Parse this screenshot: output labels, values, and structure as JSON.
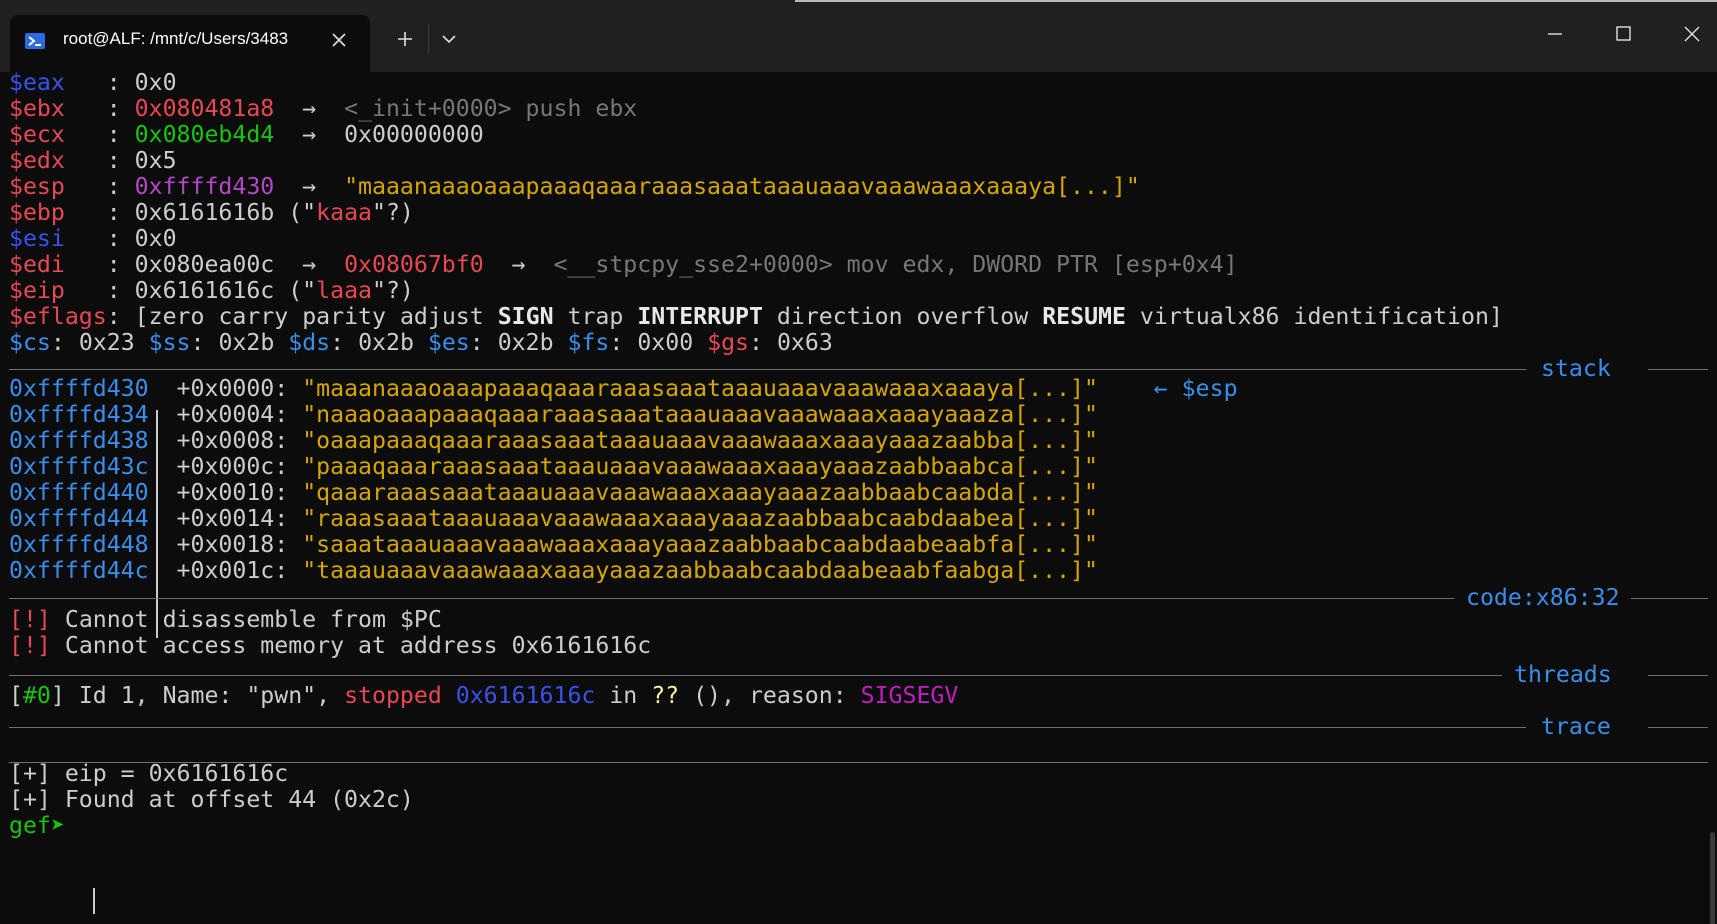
{
  "window": {
    "tab_title": "root@ALF: /mnt/c/Users/3483",
    "icons": {
      "tab": "terminal-icon",
      "close_tab": "close-icon",
      "new_tab": "plus-icon",
      "dropdown": "chevron-down-icon",
      "minimize": "minimize-icon",
      "maximize": "maximize-icon",
      "close_window": "close-icon"
    }
  },
  "colors": {
    "background": "#0c0c0c",
    "titlebar": "#202020",
    "register_blue": "#3b52e8",
    "register_red": "#e74856",
    "address_blue": "#3b8eea",
    "string_yellow": "#d6a600",
    "heap_green": "#16c60c",
    "stack_purple": "#b148c6",
    "signal_magenta": "#c01ec0"
  },
  "registers": {
    "eax": {
      "name": "$eax",
      "pad": "   ",
      "value": "0x0"
    },
    "ebx": {
      "name": "$ebx",
      "pad": "   ",
      "value": "0x080481a8",
      "arrow": "→",
      "deref": "<_init+0000> push ebx"
    },
    "ecx": {
      "name": "$ecx",
      "pad": "   ",
      "value": "0x080eb4d4",
      "arrow": "→",
      "deref": "0x00000000"
    },
    "edx": {
      "name": "$edx",
      "pad": "   ",
      "value": "0x5"
    },
    "esp": {
      "name": "$esp",
      "pad": "   ",
      "value": "0xffffd430",
      "arrow": "→",
      "deref": "\"maaanaaaoaaapaaaqaaaraaasaaataaauaaavaaawaaaxaaaya[...]\""
    },
    "ebp": {
      "name": "$ebp",
      "pad": "   ",
      "value": "0x6161616b",
      "open": " (\"",
      "ascii": "kaaa",
      "close": "\"?)"
    },
    "esi": {
      "name": "$esi",
      "pad": "   ",
      "value": "0x0"
    },
    "edi": {
      "name": "$edi",
      "pad": "   ",
      "value": "0x080ea00c",
      "arrow": "→",
      "deref_ptr": "0x08067bf0",
      "arrow2": "→",
      "deref": "<__stpcpy_sse2+0000> mov edx, DWORD PTR [esp+0x4]"
    },
    "eip": {
      "name": "$eip",
      "pad": "   ",
      "value": "0x6161616c",
      "open": " (\"",
      "ascii": "laaa",
      "close": "\"?)"
    },
    "eflags": {
      "name": "$eflags",
      "open": "[",
      "flags": [
        "zero",
        "carry",
        "parity",
        "adjust",
        "SIGN",
        "trap",
        "INTERRUPT",
        "direction",
        "overflow",
        "RESUME",
        "virtualx86",
        "identification"
      ],
      "close": "]"
    },
    "segments": [
      {
        "name": "$cs",
        "value": "0x23"
      },
      {
        "name": "$ss",
        "value": "0x2b"
      },
      {
        "name": "$ds",
        "value": "0x2b"
      },
      {
        "name": "$es",
        "value": "0x2b"
      },
      {
        "name": "$fs",
        "value": "0x00"
      },
      {
        "name": "$gs",
        "value": "0x63"
      }
    ]
  },
  "sections": {
    "stack": "stack",
    "code": "code:x86:32",
    "threads": "threads",
    "trace": "trace"
  },
  "stack": {
    "rows": [
      {
        "addr": "0xffffd430",
        "offset": "+0x0000:",
        "value": "\"maaanaaaoaaapaaaqaaaraaasaaataaauaaavaaawaaaxaaaya[...]\"",
        "pointer": "← $esp"
      },
      {
        "addr": "0xffffd434",
        "offset": "+0x0004:",
        "value": "\"naaaoaaapaaaqaaaraaasaaataaauaaavaaawaaaxaaayaaaza[...]\""
      },
      {
        "addr": "0xffffd438",
        "offset": "+0x0008:",
        "value": "\"oaaapaaaqaaaraaasaaataaauaaavaaawaaaxaaayaaazaabba[...]\""
      },
      {
        "addr": "0xffffd43c",
        "offset": "+0x000c:",
        "value": "\"paaaqaaaraaasaaataaauaaavaaawaaaxaaayaaazaabbaabca[...]\""
      },
      {
        "addr": "0xffffd440",
        "offset": "+0x0010:",
        "value": "\"qaaaraaasaaataaauaaavaaawaaaxaaayaaazaabbaabcaabda[...]\""
      },
      {
        "addr": "0xffffd444",
        "offset": "+0x0014:",
        "value": "\"raaasaaataaauaaavaaawaaaxaaayaaazaabbaabcaabdaabea[...]\""
      },
      {
        "addr": "0xffffd448",
        "offset": "+0x0018:",
        "value": "\"saaataaauaaavaaawaaaxaaayaaazaabbaabcaabdaabeaabfa[...]\""
      },
      {
        "addr": "0xffffd44c",
        "offset": "+0x001c:",
        "value": "\"taaauaaavaaawaaaxaaayaaazaabbaabcaabdaabeaabfaabga[...]\""
      }
    ]
  },
  "code": {
    "errors": [
      {
        "tag": "[!]",
        "text": "Cannot disassemble from $PC"
      },
      {
        "tag": "[!]",
        "text": "Cannot access memory at address 0x6161616c"
      }
    ]
  },
  "threads": {
    "open": "[",
    "num": "#0",
    "close": "]",
    "id_name": " Id 1, Name: \"pwn\", ",
    "state": "stopped",
    "addr": "0x6161616c",
    "in_word": " in ",
    "func": "??",
    "reason_label": " (), reason: ",
    "signal": "SIGSEGV"
  },
  "output": [
    "[+] eip = 0x6161616c",
    "[+] Found at offset 44 (0x2c)"
  ],
  "prompt": {
    "text": "gef➤",
    "trailing": " "
  }
}
